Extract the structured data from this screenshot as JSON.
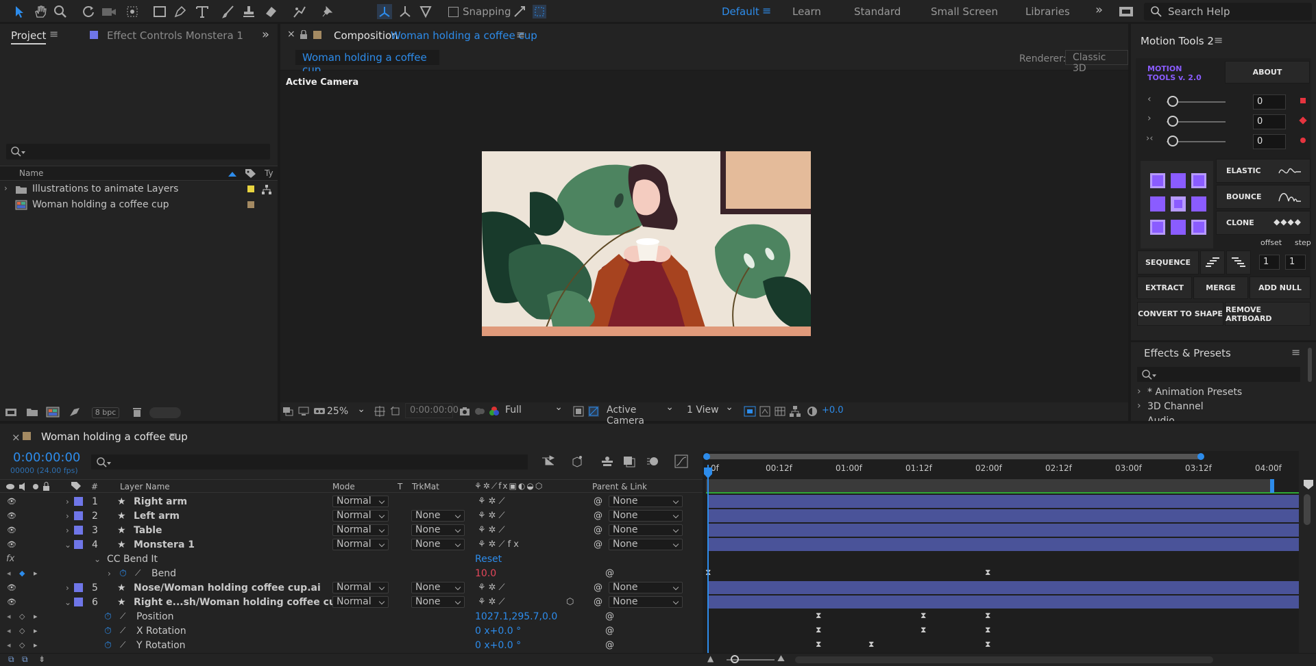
{
  "toolbar": {
    "snapping_label": "Snapping",
    "workspaces": [
      "Default",
      "Learn",
      "Standard",
      "Small Screen",
      "Libraries"
    ],
    "search_placeholder": "Search Help"
  },
  "project": {
    "tab_label": "Project",
    "effect_controls_label": "Effect Controls Monstera 1",
    "col_name": "Name",
    "col_type": "Ty",
    "items": [
      {
        "label": "Illustrations to animate Layers",
        "label_color": "#e8d440",
        "kind": "folder"
      },
      {
        "label": "Woman holding a coffee cup",
        "label_color": "#a48a62",
        "kind": "composition"
      }
    ],
    "bpc": "8 bpc"
  },
  "composition": {
    "tab_prefix": "Composition",
    "tab_name": "Woman holding a coffee cup",
    "subtab": "Woman holding a coffee cup",
    "renderer_label": "Renderer:",
    "renderer_value": "Classic 3D",
    "viewer_label": "Active Camera",
    "zoom": "25%",
    "timecode": "0:00:00:00",
    "resolution": "Full",
    "camera": "Active Camera",
    "views": "1 View",
    "exposure": "+0.0"
  },
  "motion_tools": {
    "title": "Motion Tools 2",
    "logo_line1": "MOTION",
    "logo_line2": "TOOLS v. 2.0",
    "about": "ABOUT",
    "slider_values": [
      "0",
      "0",
      "0"
    ],
    "elastic": "ELASTIC",
    "bounce": "BOUNCE",
    "clone": "CLONE",
    "offset": "offset",
    "step": "step",
    "sequence": "SEQUENCE",
    "seq_values": [
      "1",
      "1"
    ],
    "extract": "EXTRACT",
    "merge": "MERGE",
    "add_null": "ADD NULL",
    "convert_to_shape": "CONVERT TO SHAPE",
    "remove_artboard": "REMOVE ARTBOARD",
    "accent": "#7b4cff"
  },
  "effects": {
    "title": "Effects & Presets",
    "items": [
      "* Animation Presets",
      "3D Channel",
      "Audio"
    ]
  },
  "timeline": {
    "comp_name": "Woman holding a coffee cup",
    "timecode": "0:00:00:00",
    "frames": "00000 (24.00 fps)",
    "headers": {
      "layer_name": "Layer Name",
      "mode": "Mode",
      "t": "T",
      "trkmat": "TrkMat",
      "parent": "Parent & Link",
      "num": "#"
    },
    "ruler": [
      "0f",
      "00:12f",
      "01:00f",
      "01:12f",
      "02:00f",
      "02:12f",
      "03:00f",
      "03:12f",
      "04:00f"
    ],
    "layers": [
      {
        "num": "1",
        "name": "Right arm",
        "mode": "Normal",
        "trkmat": "",
        "parent": "None"
      },
      {
        "num": "2",
        "name": "Left arm",
        "mode": "Normal",
        "trkmat": "None",
        "parent": "None"
      },
      {
        "num": "3",
        "name": "Table",
        "mode": "Normal",
        "trkmat": "None",
        "parent": "None"
      },
      {
        "num": "4",
        "name": "Monstera 1",
        "mode": "Normal",
        "trkmat": "None",
        "parent": "None"
      },
      {
        "num": "5",
        "name": "Nose/Woman holding coffee cup.ai",
        "mode": "Normal",
        "trkmat": "None",
        "parent": "None"
      },
      {
        "num": "6",
        "name": "Right e...sh/Woman holding coffee cup.ai",
        "mode": "Normal",
        "trkmat": "None",
        "parent": "None"
      }
    ],
    "effect": {
      "name": "CC Bend It",
      "reset": "Reset",
      "prop": "Bend",
      "value": "10.0"
    },
    "props": [
      {
        "name": "Position",
        "value": "1027.1,295.7,0.0"
      },
      {
        "name": "X Rotation",
        "value": "0 x+0.0 °"
      },
      {
        "name": "Y Rotation",
        "value": "0 x+0.0 °"
      }
    ]
  }
}
